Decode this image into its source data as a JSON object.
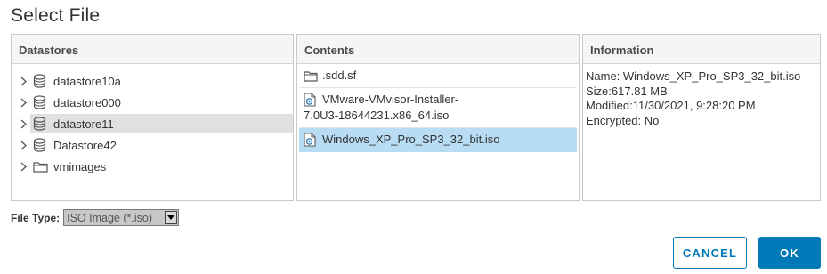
{
  "dialog": {
    "title": "Select File"
  },
  "datastores": {
    "header": "Datastores",
    "items": [
      {
        "label": "datastore10a",
        "icon": "database-icon",
        "selected": false
      },
      {
        "label": "datastore000",
        "icon": "database-icon",
        "selected": false
      },
      {
        "label": "datastore11",
        "icon": "database-icon",
        "selected": true
      },
      {
        "label": "Datastore42",
        "icon": "database-icon",
        "selected": false
      },
      {
        "label": "vmimages",
        "icon": "folder-icon",
        "selected": false
      }
    ]
  },
  "contents": {
    "header": "Contents",
    "items": [
      {
        "line1": ".sdd.sf",
        "line2": "",
        "icon": "folder-icon",
        "selected": false
      },
      {
        "line1": "VMware-VMvisor-Installer-",
        "line2": "7.0U3-18644231.x86_64.iso",
        "icon": "iso-file-icon",
        "selected": false
      },
      {
        "line1": "Windows_XP_Pro_SP3_32_bit.iso",
        "line2": "",
        "icon": "iso-file-icon",
        "selected": true
      }
    ]
  },
  "information": {
    "header": "Information",
    "name": "Name: Windows_XP_Pro_SP3_32_bit.iso",
    "size": "Size:617.81 MB",
    "modified": "Modified:11/30/2021, 9:28:20 PM",
    "encrypted": "Encrypted: No"
  },
  "file_type": {
    "label": "File Type:",
    "value": "ISO Image (*.iso)"
  },
  "buttons": {
    "cancel": "CANCEL",
    "ok": "OK"
  },
  "colors": {
    "accent": "#0079b8",
    "selection": "#b7dcf4",
    "tree_selection": "#e0e0e0"
  }
}
